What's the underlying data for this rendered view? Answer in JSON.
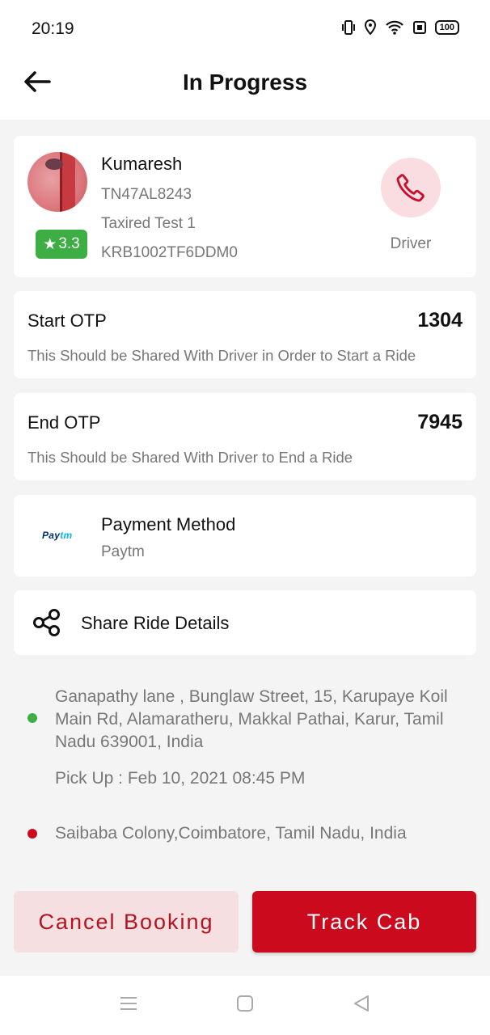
{
  "status_bar": {
    "time": "20:19",
    "battery": "100",
    "icons": [
      "vibrate-icon",
      "location-icon",
      "wifi-icon",
      "nfc-icon",
      "battery-icon"
    ]
  },
  "header": {
    "title": "In Progress",
    "back_icon": "arrow-left-icon"
  },
  "driver": {
    "name": "Kumaresh",
    "vehicle_number": "TN47AL8243",
    "vehicle_model": "Taxired Test 1",
    "driver_id": "KRB1002TF6DDM0",
    "rating": "3.3",
    "call_label": "Driver"
  },
  "start_otp": {
    "title": "Start OTP",
    "value": "1304",
    "description": "This Should be Shared With Driver in Order to Start a Ride"
  },
  "end_otp": {
    "title": "End OTP",
    "value": "7945",
    "description": "This Should be Shared With Driver to End a Ride"
  },
  "payment": {
    "title": "Payment Method",
    "method": "Paytm",
    "logo_text_dark": "Pay",
    "logo_text_light": "tm"
  },
  "share": {
    "label": "Share Ride Details"
  },
  "route": {
    "pickup_address": "Ganapathy lane , Bunglaw Street, 15, Karupaye Koil Main Rd, Alamaratheru, Makkal Pathai, Karur, Tamil Nadu 639001, India",
    "pickup_time": "Pick Up : Feb 10, 2021 08:45 PM",
    "drop_address": "Saibaba Colony,Coimbatore, Tamil Nadu, India"
  },
  "actions": {
    "cancel_label": "Cancel Booking",
    "track_label": "Track Cab"
  },
  "colors": {
    "accent": "#cc0a1e",
    "pickup_dot": "#3dae44",
    "drop_dot": "#cc0a1e",
    "rating_badge": "#3dae44"
  }
}
